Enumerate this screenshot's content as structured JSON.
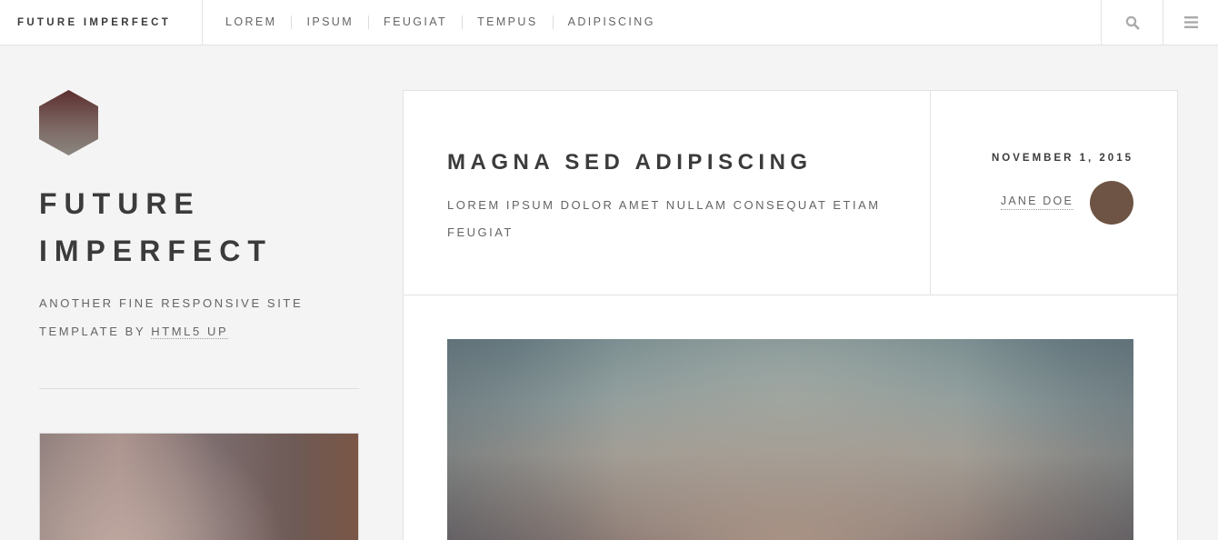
{
  "header": {
    "brand": "Future Imperfect",
    "nav": [
      "Lorem",
      "Ipsum",
      "Feugiat",
      "Tempus",
      "Adipiscing"
    ],
    "search_icon": "search-icon",
    "menu_icon": "hamburger-menu-icon"
  },
  "sidebar": {
    "title_line1": "Future",
    "title_line2": "Imperfect",
    "tagline_prefix": "Another fine responsive site template by",
    "tagline_link": "HTML5 UP"
  },
  "post": {
    "title": "Magna sed adipiscing",
    "subtitle": "Lorem ipsum dolor amet nullam consequat etiam feugiat",
    "date": "November 1, 2015",
    "author": "Jane Doe"
  },
  "colors": {
    "background": "#f4f4f4",
    "panel": "#ffffff",
    "text_dark": "#3c3b3b",
    "text_muted": "#646464",
    "border": "#e2e2e2",
    "avatar": "#6e5444"
  }
}
